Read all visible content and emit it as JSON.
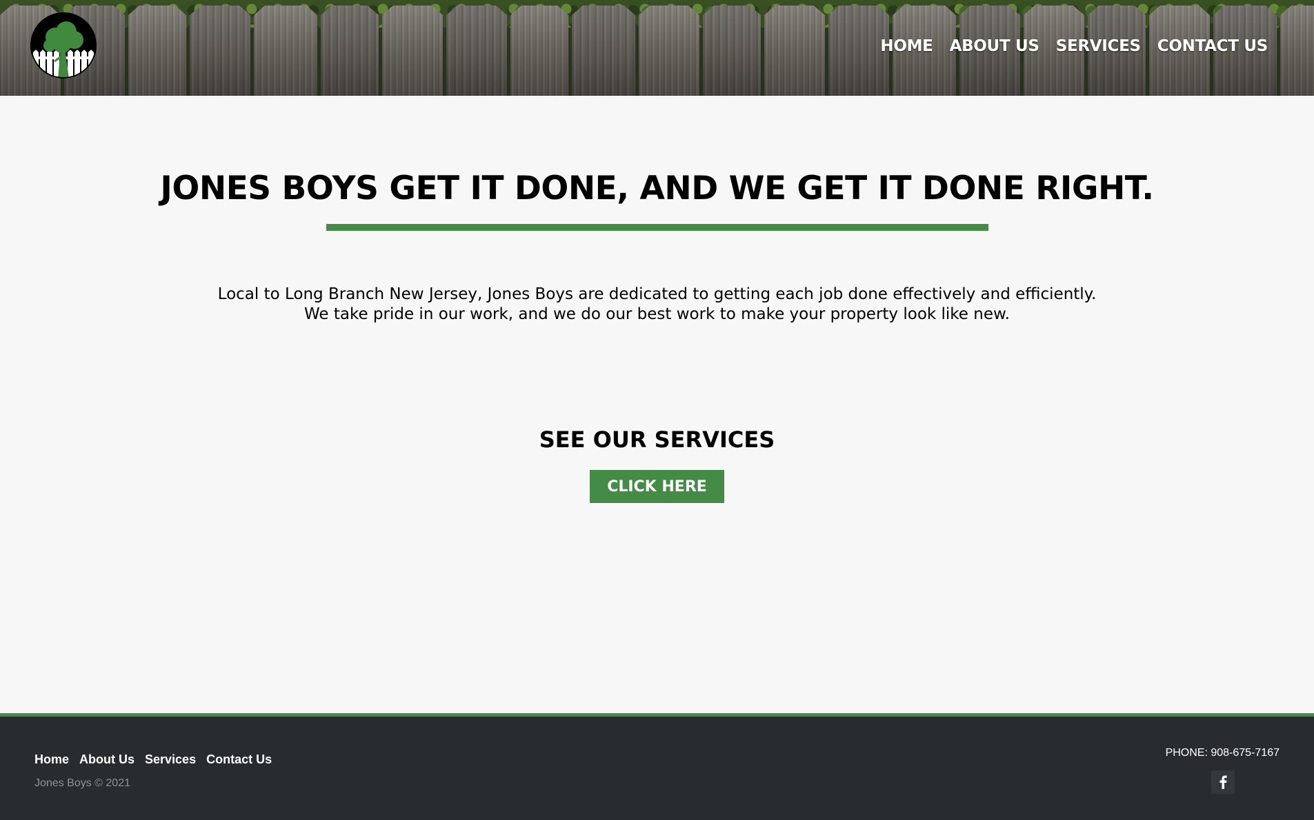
{
  "header": {
    "logo_icon": "tree-fence-logo",
    "nav": [
      {
        "label": "HOME"
      },
      {
        "label": "ABOUT US"
      },
      {
        "label": "SERVICES"
      },
      {
        "label": "CONTACT US"
      }
    ]
  },
  "main": {
    "headline": "JONES BOYS GET IT DONE, AND WE GET IT DONE RIGHT.",
    "intro_line1": "Local to Long Branch New Jersey, Jones Boys are dedicated to getting each job done effectively and efficiently.",
    "intro_line2": "We take pride in our work, and we do our best work to make your property look like new.",
    "cta_title": "SEE OUR SERVICES",
    "cta_button": "CLICK HERE"
  },
  "footer": {
    "nav": [
      {
        "label": "Home"
      },
      {
        "label": "About Us"
      },
      {
        "label": "Services"
      },
      {
        "label": "Contact Us"
      }
    ],
    "copyright": "Jones Boys © 2021",
    "phone": "PHONE: 908-675-7167",
    "social_icon": "facebook-icon"
  },
  "colors": {
    "accent_green": "#448b46",
    "footer_bg": "#292c2f",
    "page_bg": "#f7f7f7"
  }
}
